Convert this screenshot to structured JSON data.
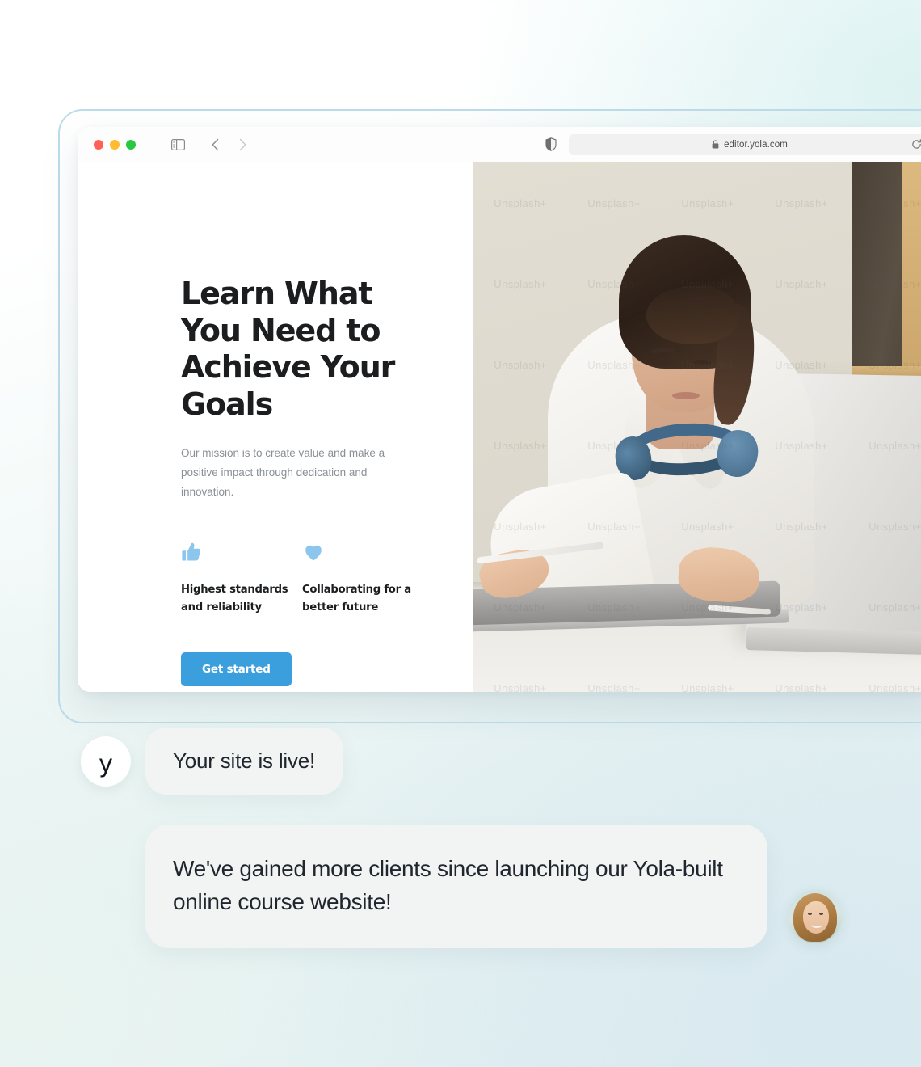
{
  "browser": {
    "url": "editor.yola.com",
    "lock_icon": "lock-icon",
    "traffic_lights": [
      "close-red",
      "minimize-yellow",
      "maximize-green"
    ],
    "sidebar_toggle": "sidebar-toggle-icon",
    "back": "chevron-left-icon",
    "forward": "chevron-right-icon",
    "shield": "shield-privacy-icon",
    "reload": "reload-icon"
  },
  "site": {
    "hero": {
      "title": "Learn What You Need to Achieve Your Goals",
      "subtitle": "Our mission is to create value and make a positive impact through dedication and innovation.",
      "features": [
        {
          "icon": "thumbs-up-icon",
          "label": "Highest standards and reliability"
        },
        {
          "icon": "heart-icon",
          "label": "Collaborating for a better future"
        }
      ],
      "cta_label": "Get started"
    },
    "photo": {
      "alt": "Woman with blue headphones working at a laptop and tablet",
      "watermark": "Unsplash+"
    }
  },
  "chat": {
    "brand_avatar_letter": "y",
    "messages": [
      {
        "text": "Your site is live!",
        "from": "yola"
      },
      {
        "text": "We've gained more clients since launching our Yola-built online course website!",
        "from": "customer"
      }
    ],
    "customer_avatar": "smiling-woman-avatar"
  },
  "colors": {
    "cta_blue": "#3b9fdd",
    "feature_icon_blue": "#8cc6ec",
    "frame_outline": "#bcdcea",
    "bubble_grey": "#f2f4f4",
    "heading": "#1b1d1f",
    "body_text": "#8b9096"
  }
}
